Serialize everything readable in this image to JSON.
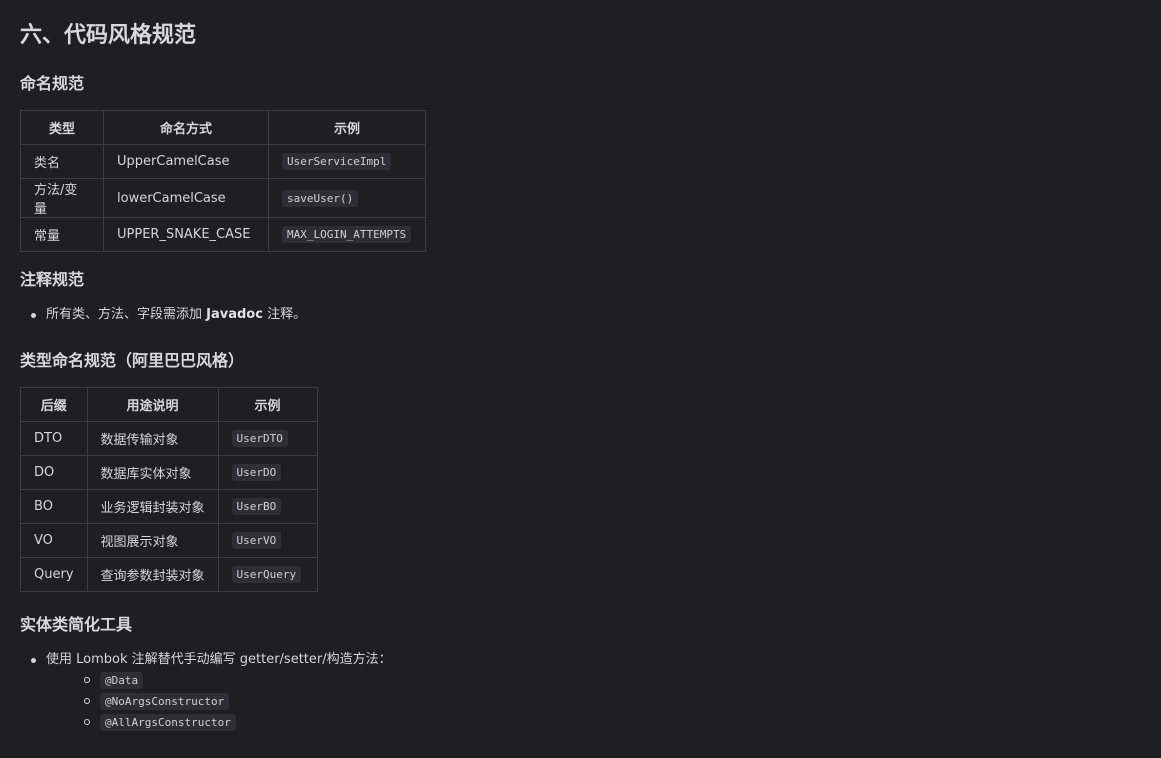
{
  "title": "六、代码风格规范",
  "naming": {
    "heading": "命名规范",
    "headers": [
      "类型",
      "命名方式",
      "示例"
    ],
    "rows": [
      {
        "type": "类名",
        "style": "UpperCamelCase",
        "example": "UserServiceImpl"
      },
      {
        "type": "方法/变量",
        "style": "lowerCamelCase",
        "example": "saveUser()"
      },
      {
        "type": "常量",
        "style": "UPPER_SNAKE_CASE",
        "example": "MAX_LOGIN_ATTEMPTS"
      }
    ]
  },
  "comments": {
    "heading": "注释规范",
    "item_prefix": "所有类、方法、字段需添加 ",
    "item_bold": "Javadoc",
    "item_suffix": " 注释。"
  },
  "type_naming": {
    "heading": "类型命名规范（阿里巴巴风格）",
    "headers": [
      "后缀",
      "用途说明",
      "示例"
    ],
    "rows": [
      {
        "suffix": "DTO",
        "desc": "数据传输对象",
        "example": "UserDTO"
      },
      {
        "suffix": "DO",
        "desc": "数据库实体对象",
        "example": "UserDO"
      },
      {
        "suffix": "BO",
        "desc": "业务逻辑封装对象",
        "example": "UserBO"
      },
      {
        "suffix": "VO",
        "desc": "视图展示对象",
        "example": "UserVO"
      },
      {
        "suffix": "Query",
        "desc": "查询参数封装对象",
        "example": "UserQuery"
      }
    ]
  },
  "entity_tools": {
    "heading": "实体类简化工具",
    "item": "使用 Lombok 注解替代手动编写 getter/setter/构造方法：",
    "annotations": [
      "@Data",
      "@NoArgsConstructor",
      "@AllArgsConstructor"
    ]
  }
}
